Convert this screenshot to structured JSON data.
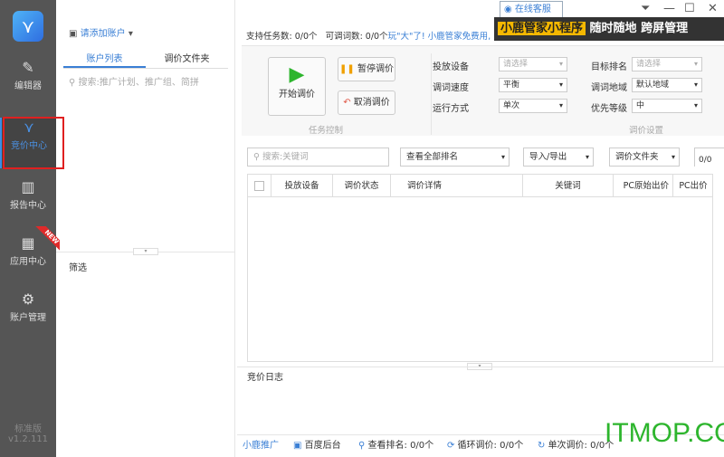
{
  "sidebar": {
    "logo": "deer-logo",
    "items": [
      {
        "label": "编辑器",
        "icon": "edit-icon"
      },
      {
        "label": "竞价中心",
        "icon": "bid-icon"
      },
      {
        "label": "报告中心",
        "icon": "chart-icon"
      },
      {
        "label": "应用中心",
        "icon": "apps-icon",
        "badge": "NEW"
      },
      {
        "label": "账户管理",
        "icon": "user-gear-icon"
      }
    ],
    "edition": "标准版",
    "version": "v1.2.111"
  },
  "left": {
    "account": "请添加账户",
    "tabs": [
      "账户列表",
      "调价文件夹"
    ],
    "search_placeholder": "搜索:推广计划、推广组、简拼",
    "filter": "筛选"
  },
  "header": {
    "task_count": "支持任务数: 0/0个",
    "word_count": "可调词数: 0/0个",
    "promo_link": "玩\"大\"了! 小鹿管家免费用,",
    "service": "在线客服",
    "banner_highlight": "小鹿管家小程序",
    "banner_text": "随时随地 跨屏管理"
  },
  "control": {
    "start": "开始调价",
    "pause": "暂停调价",
    "cancel": "取消调价",
    "group1": "任务控制",
    "group2": "调价设置",
    "fields": [
      {
        "label": "投放设备",
        "value": "请选择",
        "placeholder": true
      },
      {
        "label": "调词速度",
        "value": "平衡"
      },
      {
        "label": "运行方式",
        "value": "单次"
      },
      {
        "label": "目标排名",
        "value": "请选择",
        "placeholder": true
      },
      {
        "label": "调词地域",
        "value": "默认地域"
      },
      {
        "label": "优先等级",
        "value": "中"
      }
    ]
  },
  "toolbar": {
    "search_placeholder": "搜索:关键词",
    "rank_filter": "查看全部排名",
    "import_export": "导入/导出",
    "folder": "调价文件夹",
    "page": "0/0"
  },
  "table": {
    "columns": [
      "投放设备",
      "调价状态",
      "调价详情",
      "关键词",
      "PC原始出价",
      "PC出价"
    ]
  },
  "log": {
    "title": "竞价日志"
  },
  "footer": {
    "brand": "小鹿推广",
    "baidu": "百度后台",
    "rank": "查看排名: 0/0个",
    "loop": "循环调价: 0/0个",
    "single": "单次调价:",
    "single_value": "0/0个"
  },
  "watermark": "ITMOP.COM"
}
